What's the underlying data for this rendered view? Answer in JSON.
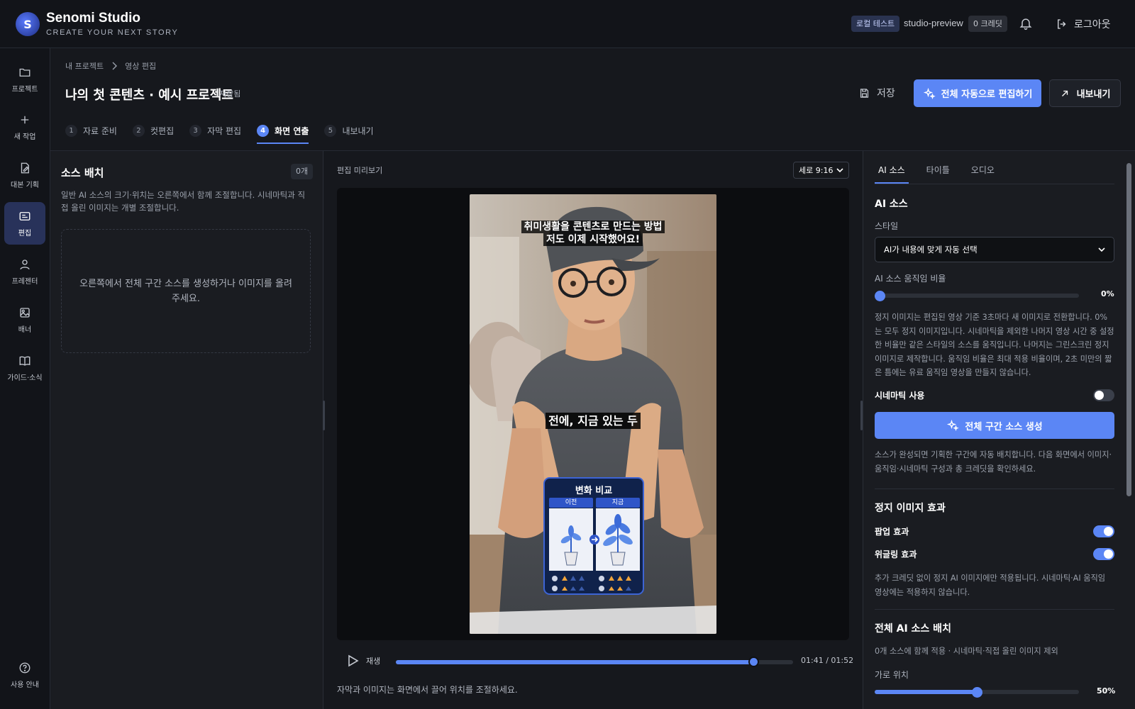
{
  "app": {
    "title": "Senomi Studio",
    "subtitle": "CREATE YOUR NEXT STORY",
    "logo_letter": "S"
  },
  "topbar": {
    "local_badge": "로컬 테스트",
    "user": "studio-preview",
    "credits": "0 크레딧",
    "logout": "로그아웃"
  },
  "sidebar": {
    "items": [
      {
        "label": "프로젝트",
        "icon": "folder-icon"
      },
      {
        "label": "새 작업",
        "icon": "plus-icon"
      },
      {
        "label": "대본 기획",
        "icon": "edit-document-icon"
      },
      {
        "label": "편집",
        "icon": "editor-icon"
      },
      {
        "label": "프레젠터",
        "icon": "person-icon"
      },
      {
        "label": "배너",
        "icon": "image-icon"
      },
      {
        "label": "가이드·소식",
        "icon": "book-icon"
      }
    ],
    "help": "사용 안내"
  },
  "breadcrumb": {
    "root": "내 프로젝트",
    "current": "영상 편집"
  },
  "project": {
    "title": "나의 첫 콘텐츠 · 예시 프로젝트",
    "status": "저장됨"
  },
  "actions": {
    "save": "저장",
    "auto_edit": "전체 자동으로 편집하기",
    "export": "내보내기"
  },
  "steps": [
    {
      "num": "1",
      "label": "자료 준비"
    },
    {
      "num": "2",
      "label": "컷편집"
    },
    {
      "num": "3",
      "label": "자막 편집"
    },
    {
      "num": "4",
      "label": "화면 연출"
    },
    {
      "num": "5",
      "label": "내보내기"
    }
  ],
  "left_panel": {
    "title": "소스 배치",
    "count": "0개",
    "description": "일반 AI 소스의 크기·위치는 오른쪽에서 함께 조절합니다. 시네마틱과 직접 올린 이미지는 개별 조절합니다.",
    "empty": "오른쪽에서 전체 구간 소스를 생성하거나 이미지를 올려주세요."
  },
  "preview": {
    "label": "편집 미리보기",
    "ratio": "세로 9:16",
    "subtitle_top_1": "취미생활을 콘텐츠로 만드는 방법",
    "subtitle_top_2": "저도 이제 시작했어요!",
    "subtitle_mid": "전에, 지금 있는 두",
    "card_title": "변화 비교",
    "card_before": "이전",
    "card_after": "지금",
    "play": "재생",
    "time": "01:41 / 01:52",
    "progress": 0.9,
    "hint": "자막과 이미지는 화면에서 끌어 위치를 조절하세요."
  },
  "right_panel": {
    "tabs": [
      "AI 소스",
      "타이틀",
      "오디오"
    ],
    "section_title": "AI 소스",
    "style_label": "스타일",
    "style_value": "AI가 내용에 맞게 자동 선택",
    "motion_label": "AI 소스 움직임 비율",
    "motion_value": "0%",
    "motion_level": 0,
    "motion_desc": "정지 이미지는 편집된 영상 기준 3초마다 새 이미지로 전환합니다. 0%는 모두 정지 이미지입니다. 시네마틱을 제외한 나머지 영상 시간 중 설정한 비율만 같은 스타일의 소스를 움직입니다. 나머지는 그린스크린 정지 이미지로 제작합니다. 움직임 비율은 최대 적용 비율이며, 2초 미만의 짧은 틈에는 유료 움직임 영상을 만들지 않습니다.",
    "cinematic_label": "시네마틱 사용",
    "cinematic_on": false,
    "generate_btn": "전체 구간 소스 생성",
    "generate_desc": "소스가 완성되면 기획한 구간에 자동 배치합니다. 다음 화면에서 이미지·움직임·시네마틱 구성과 총 크레딧을 확인하세요.",
    "still_title": "정지 이미지 효과",
    "popup_label": "팝업 효과",
    "popup_on": true,
    "wiggle_label": "위글링 효과",
    "wiggle_on": true,
    "still_desc": "추가 크레딧 없이 정지 AI 이미지에만 적용됩니다. 시네마틱·AI 움직임 영상에는 적용하지 않습니다.",
    "layout_title": "전체 AI 소스 배치",
    "layout_desc": "0개 소스에 함께 적용 · 시네마틱·직접 올린 이미지 제외",
    "hpos_label": "가로 위치",
    "hpos_value": "50%",
    "hpos_level": 0.5
  },
  "colors": {
    "accent": "#5b86f5",
    "bg": "#16181d",
    "panel": "#1a1c21"
  }
}
